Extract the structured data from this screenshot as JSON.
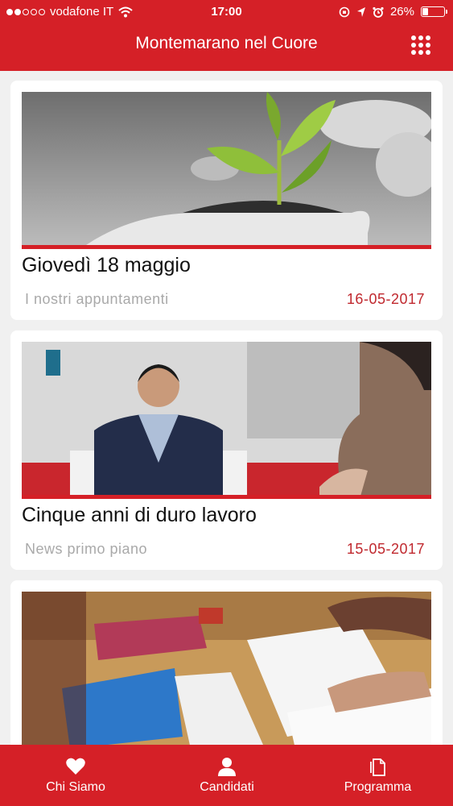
{
  "status": {
    "carrier": "vodafone IT",
    "time": "17:00",
    "battery": "26%",
    "battery_level": 0.26
  },
  "header": {
    "title": "Montemarano nel Cuore",
    "menu_icon": "grid-icon"
  },
  "posts": [
    {
      "title": "Giovedì 18 maggio",
      "category": "I nostri appuntamenti",
      "date": "16-05-2017"
    },
    {
      "title": "Cinque anni di duro lavoro",
      "category": "News primo piano",
      "date": "15-05-2017"
    },
    {
      "title": "",
      "category": "",
      "date": ""
    }
  ],
  "tabs": [
    {
      "label": "Chi Siamo",
      "icon": "heart-icon"
    },
    {
      "label": "Candidati",
      "icon": "person-icon"
    },
    {
      "label": "Programma",
      "icon": "document-icon"
    }
  ],
  "colors": {
    "brand": "#d52027",
    "date": "#c0282e",
    "category": "#a9a9a9"
  }
}
